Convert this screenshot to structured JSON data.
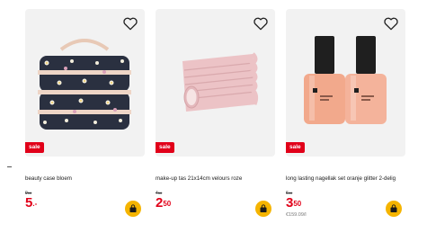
{
  "products": [
    {
      "name": "beauty case bloem",
      "badge": "sale",
      "old_price_main": "9",
      "old_price_frac": "00",
      "price_main": "5",
      "price_frac": ".-",
      "unit_price": ""
    },
    {
      "name": "make-up tas 21x14cm velours roze",
      "badge": "sale",
      "old_price_main": "4",
      "old_price_frac": "50",
      "price_main": "2",
      "price_frac": "50",
      "unit_price": ""
    },
    {
      "name": "long lasting nagellak set oranje glitter 2-delig",
      "badge": "sale",
      "old_price_main": "6",
      "old_price_frac": "00",
      "price_main": "3",
      "price_frac": "50",
      "unit_price": "€159.09/l"
    }
  ],
  "colors": {
    "sale_red": "#e10019",
    "cart_yellow": "#f5b400",
    "card_bg": "#f2f2f2"
  },
  "icons": {
    "wishlist": "heart-icon",
    "cart": "shopping-bag-icon"
  }
}
